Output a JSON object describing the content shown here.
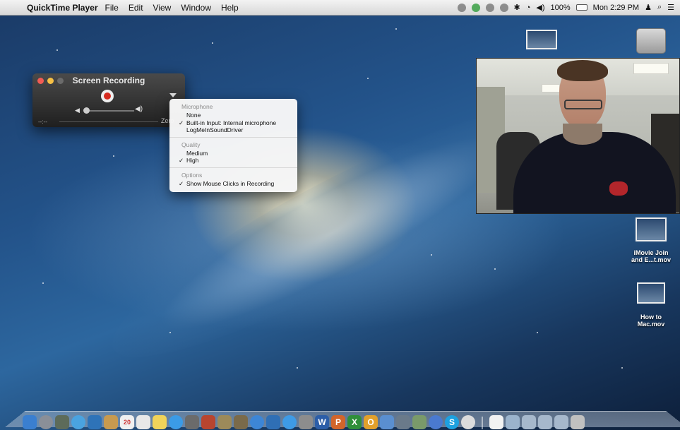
{
  "menubar": {
    "app_name": "QuickTime Player",
    "menus": [
      "File",
      "Edit",
      "View",
      "Window",
      "Help"
    ],
    "battery": "100%",
    "clock": "Mon 2:29 PM"
  },
  "recording_window": {
    "title": "Screen Recording",
    "time": "--:--",
    "size_label": "Zero"
  },
  "options_menu": {
    "microphone_header": "Microphone",
    "microphone_items": [
      {
        "label": "None",
        "checked": false
      },
      {
        "label": "Built-in Input: Internal microphone",
        "checked": true
      },
      {
        "label": "LogMeInSoundDriver",
        "checked": false
      }
    ],
    "quality_header": "Quality",
    "quality_items": [
      {
        "label": "Medium",
        "checked": false
      },
      {
        "label": "High",
        "checked": true
      }
    ],
    "options_header": "Options",
    "options_items": [
      {
        "label": "Show Mouse Clicks in Recording",
        "checked": true
      }
    ],
    "checkmark": "✓"
  },
  "desktop_icons": {
    "imovie_line1": "iMovie Join",
    "imovie_line2": "and E...t.mov",
    "howto_line1": "How to",
    "howto_line2": "Mac.mov"
  },
  "colors": {
    "record_red": "#d62a1e",
    "menubar_bg": "#e6e6e6"
  },
  "dock_calendar_day": "20"
}
